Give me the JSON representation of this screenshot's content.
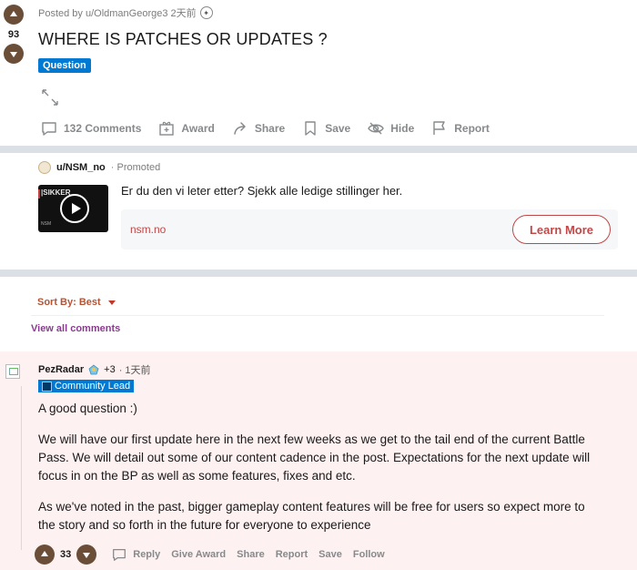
{
  "post": {
    "vote_count": "93",
    "meta": "Posted by u/OldmanGeorge3 2天前",
    "title": "WHERE IS PATCHES OR UPDATES ?",
    "flair": "Question",
    "actions": {
      "comments": "132 Comments",
      "award": "Award",
      "share": "Share",
      "save": "Save",
      "hide": "Hide",
      "report": "Report"
    }
  },
  "promoted": {
    "user": "u/NSM_no",
    "tag": "· Promoted",
    "thumb_brand": "|SIKKER",
    "thumb_org": "NSM",
    "body": "Er du den vi leter etter? Sjekk alle ledige stillinger her.",
    "domain": "nsm.no",
    "cta": "Learn More"
  },
  "sort": {
    "label": "Sort By: Best"
  },
  "view_all": "View all comments",
  "comment": {
    "user": "PezRadar",
    "karma": "+3",
    "time": "· 1天前",
    "flair": "Community Lead",
    "paragraphs": [
      "A good question :)",
      "We will have our first update here in the next few weeks as we get to the tail end of the current Battle Pass. We will detail out some of our content cadence in the post. Expectations for the next update will focus in on the BP as well as some features, fixes and etc.",
      "As we've noted in the past, bigger gameplay content features will be free for users so expect more to the story and so forth in the future for everyone to experience"
    ],
    "vote_count": "33",
    "actions": {
      "reply": "Reply",
      "give_award": "Give Award",
      "share": "Share",
      "report": "Report",
      "save": "Save",
      "follow": "Follow"
    }
  },
  "colors": {
    "vote_bg": "#6b4e37",
    "flair_blue": "#0079d3",
    "divider": "#dae0e6",
    "comment_bg": "#fdf1f1",
    "cta_red": "#c04848"
  }
}
